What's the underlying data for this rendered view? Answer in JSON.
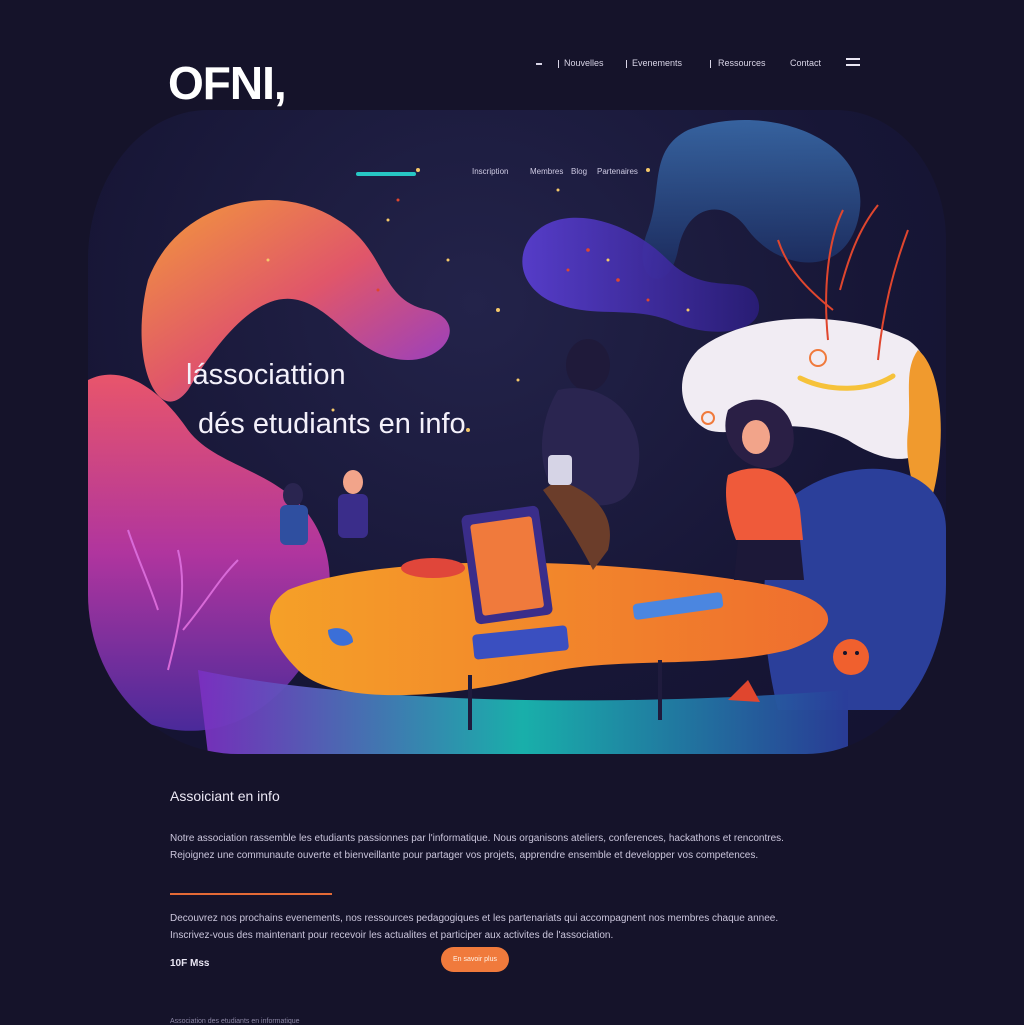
{
  "header": {
    "logo": "OFNI,",
    "nav": [
      "Nouvelles",
      "Evenements",
      "Ressources",
      "Contact"
    ]
  },
  "hero": {
    "nav": [
      "Inscription",
      "Membres",
      "Blog",
      "Partenaires"
    ],
    "title_line1": "lássociattion",
    "title_line2": "dés etudiants en info"
  },
  "section": {
    "title": "Assoiciant en info",
    "para1_line1": "Notre association rassemble les etudiants passionnes par l'informatique. Nous organisons ateliers, conferences, hackathons et rencontres.",
    "para1_line2": "Rejoignez une communaute ouverte et bienveillante pour partager vos projets, apprendre ensemble et developper vos competences.",
    "para2_line1": "Decouvrez nos prochains evenements, nos ressources pedagogiques et les partenariats qui accompagnent nos membres chaque annee.",
    "para2_line2": "Inscrivez-vous des maintenant pour recevoir les actualites et participer aux activites de l'association.",
    "small_label": "10F Mss",
    "cta_label": "En savoir plus"
  },
  "footer": {
    "text": "Association des etudiants en informatique"
  },
  "colors": {
    "background": "#15132a",
    "accent_orange": "#f07a3c",
    "accent_teal": "#27c7c4",
    "accent_purple": "#7b3fd0"
  }
}
